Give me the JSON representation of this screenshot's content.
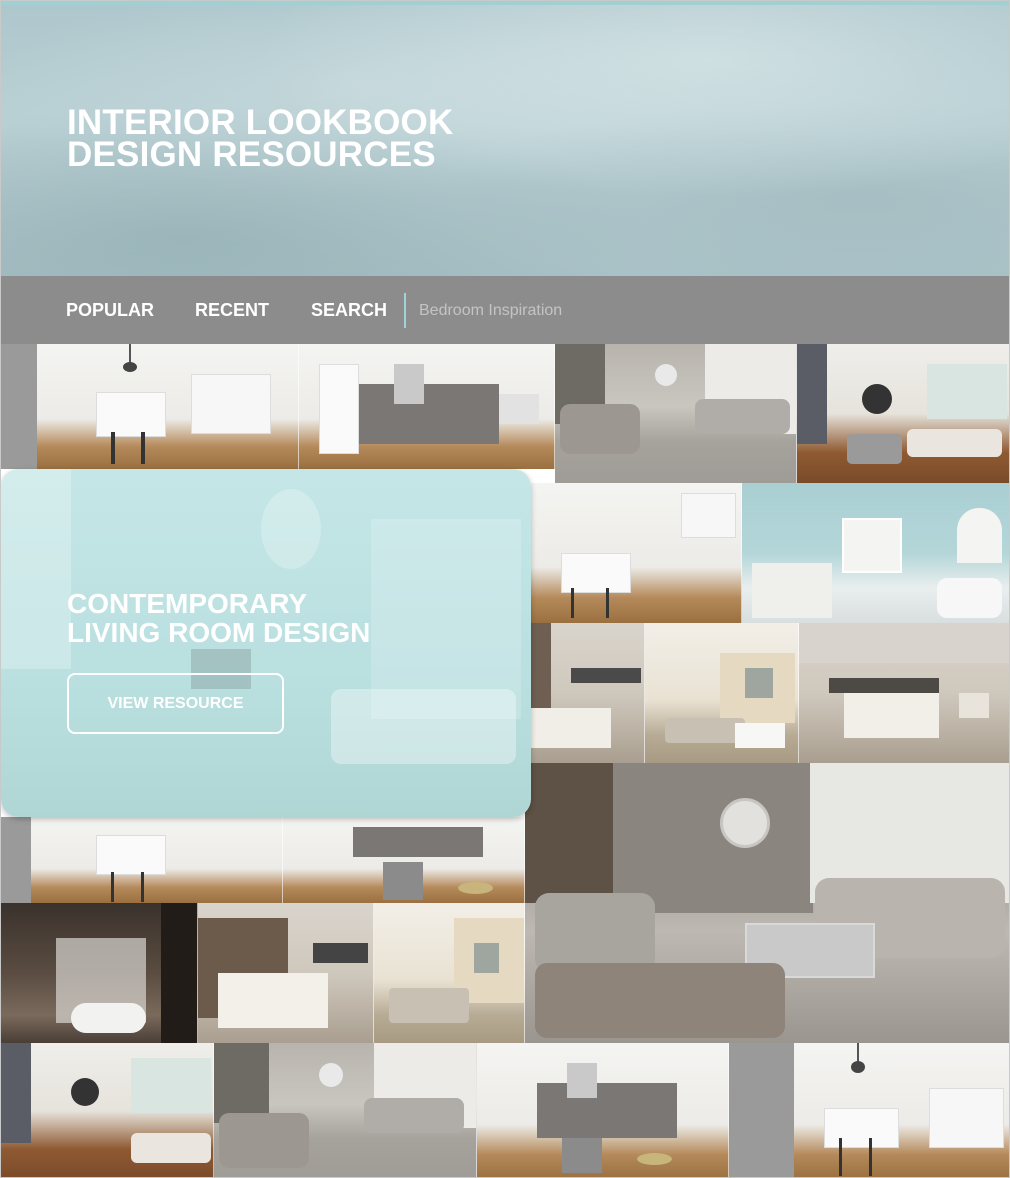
{
  "header": {
    "title_line1": "INTERIOR LOOKBOOK",
    "title_line2": "DESIGN RESOURCES"
  },
  "nav": {
    "items": [
      {
        "label": "POPULAR"
      },
      {
        "label": "RECENT"
      },
      {
        "label": "SEARCH"
      }
    ],
    "search_placeholder": "Bedroom Inspiration"
  },
  "featured": {
    "title_line1": "CONTEMPORARY",
    "title_line2": "LIVING ROOM DESIGN",
    "button_label": "VIEW RESOURCE"
  },
  "colors": {
    "header_bg": "#b4ccd0",
    "nav_bg": "#8c8c8c",
    "accent_divider": "#9ed3d8",
    "feature_overlay": "#b4dcdd"
  }
}
